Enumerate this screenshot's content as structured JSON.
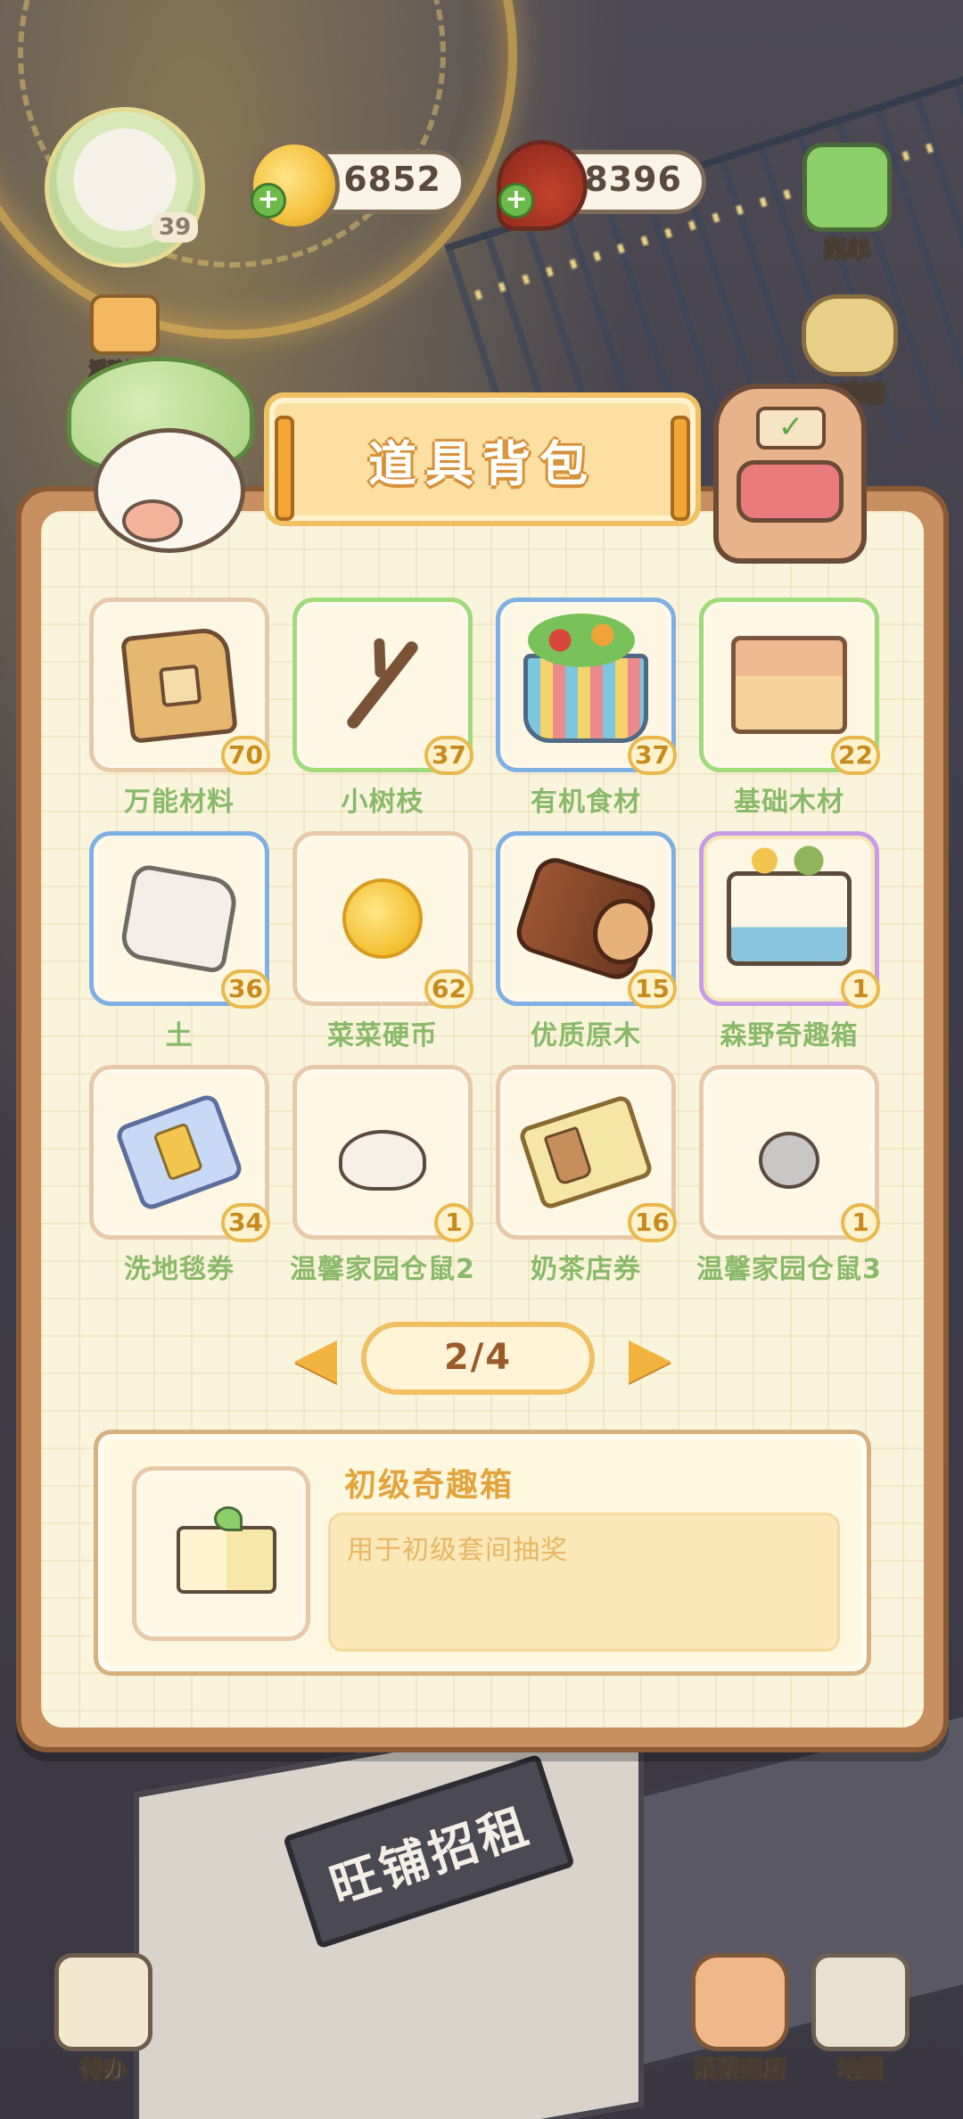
{
  "hud": {
    "level": "39",
    "gold": "6852",
    "meat": "8396",
    "plus_symbol": "+",
    "menu_label": "菜单",
    "piggy_label": "存钱罐",
    "activity_label": "活动汇总",
    "todo_label": "待办",
    "shop_label": "菜菜商店",
    "map_label": "地图"
  },
  "scene": {
    "shop_sign": "旺铺招租"
  },
  "panel": {
    "title": "道具背包"
  },
  "items": [
    {
      "name": "万能材料",
      "count": "70",
      "icon": "material-bag-icon"
    },
    {
      "name": "小树枝",
      "count": "37",
      "icon": "twig-icon"
    },
    {
      "name": "有机食材",
      "count": "37",
      "icon": "organic-food-basket-icon"
    },
    {
      "name": "基础木材",
      "count": "22",
      "icon": "wood-plank-icon"
    },
    {
      "name": "土",
      "count": "36",
      "icon": "soil-icon"
    },
    {
      "name": "菜菜硬币",
      "count": "62",
      "icon": "coin-icon"
    },
    {
      "name": "优质原木",
      "count": "15",
      "icon": "log-icon"
    },
    {
      "name": "森野奇趣箱",
      "count": "1",
      "icon": "forest-mystery-box-icon"
    },
    {
      "name": "洗地毯券",
      "count": "34",
      "icon": "carpet-ticket-icon"
    },
    {
      "name": "温馨家园仓鼠2",
      "count": "1",
      "icon": "hamster-icon"
    },
    {
      "name": "奶茶店券",
      "count": "16",
      "icon": "milk-tea-ticket-icon"
    },
    {
      "name": "温馨家园仓鼠3",
      "count": "1",
      "icon": "hamster-gray-icon"
    }
  ],
  "pager": {
    "label": "2/4"
  },
  "detail": {
    "name": "初级奇趣箱",
    "description": "用于初级套间抽奖",
    "icon": "starter-mystery-box-icon"
  }
}
